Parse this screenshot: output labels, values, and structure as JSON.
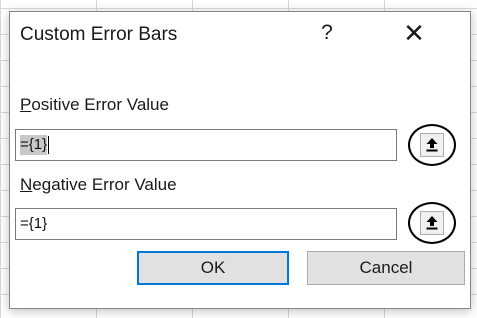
{
  "dialog": {
    "title": "Custom Error Bars",
    "help_glyph": "?",
    "close_glyph": "✕"
  },
  "positive": {
    "label_mnemonic": "P",
    "label_rest": "ositive Error Value",
    "value": "={1}"
  },
  "negative": {
    "label_mnemonic": "N",
    "label_rest": "egative Error Value",
    "value": "={1}"
  },
  "buttons": {
    "ok_label": "OK",
    "cancel_label": "Cancel"
  },
  "icons": {
    "help": "help-icon",
    "close": "close-icon",
    "range_select": "collapse-dialog-arrow-up-icon"
  },
  "colors": {
    "default_button_border": "#0078d7",
    "button_face": "#e1e1e1",
    "selection_highlight": "#c8c8c8",
    "annotation_circle": "#000000"
  }
}
